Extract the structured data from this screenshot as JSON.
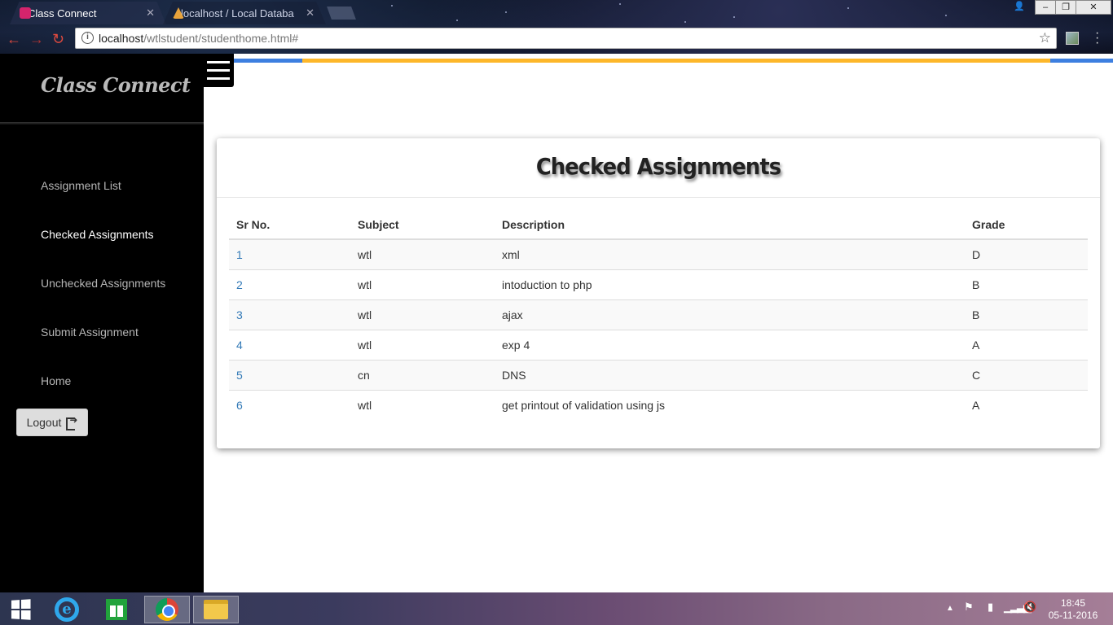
{
  "browser": {
    "tabs": [
      {
        "title": "Class Connect",
        "active": true
      },
      {
        "title": "localhost / Local Databa",
        "active": false
      }
    ],
    "url_host": "localhost",
    "url_path": "/wtlstudent/studenthome.html#"
  },
  "sidebar": {
    "brand": "Class Connect",
    "items": [
      {
        "label": "Assignment List",
        "active": false
      },
      {
        "label": "Checked Assignments",
        "active": true
      },
      {
        "label": "Unchecked Assignments",
        "active": false
      },
      {
        "label": "Submit Assignment",
        "active": false
      },
      {
        "label": "Home",
        "active": false
      }
    ],
    "logout_label": "Logout"
  },
  "colors": {
    "stripe_blue": "#3d7fe0",
    "stripe_yellow": "#fdb72a",
    "link": "#337ab7"
  },
  "panel": {
    "title": "Checked Assignments",
    "columns": [
      "Sr No.",
      "Subject",
      "Description",
      "Grade"
    ],
    "rows": [
      {
        "sr": "1",
        "subject": "wtl",
        "description": "xml",
        "grade": "D"
      },
      {
        "sr": "2",
        "subject": "wtl",
        "description": "intoduction to php",
        "grade": "B"
      },
      {
        "sr": "3",
        "subject": "wtl",
        "description": "ajax",
        "grade": "B"
      },
      {
        "sr": "4",
        "subject": "wtl",
        "description": "exp 4",
        "grade": "A"
      },
      {
        "sr": "5",
        "subject": "cn",
        "description": "DNS",
        "grade": "C"
      },
      {
        "sr": "6",
        "subject": "wtl",
        "description": "get printout of validation using js",
        "grade": "A"
      }
    ]
  },
  "taskbar": {
    "time": "18:45",
    "date": "05-11-2016"
  }
}
